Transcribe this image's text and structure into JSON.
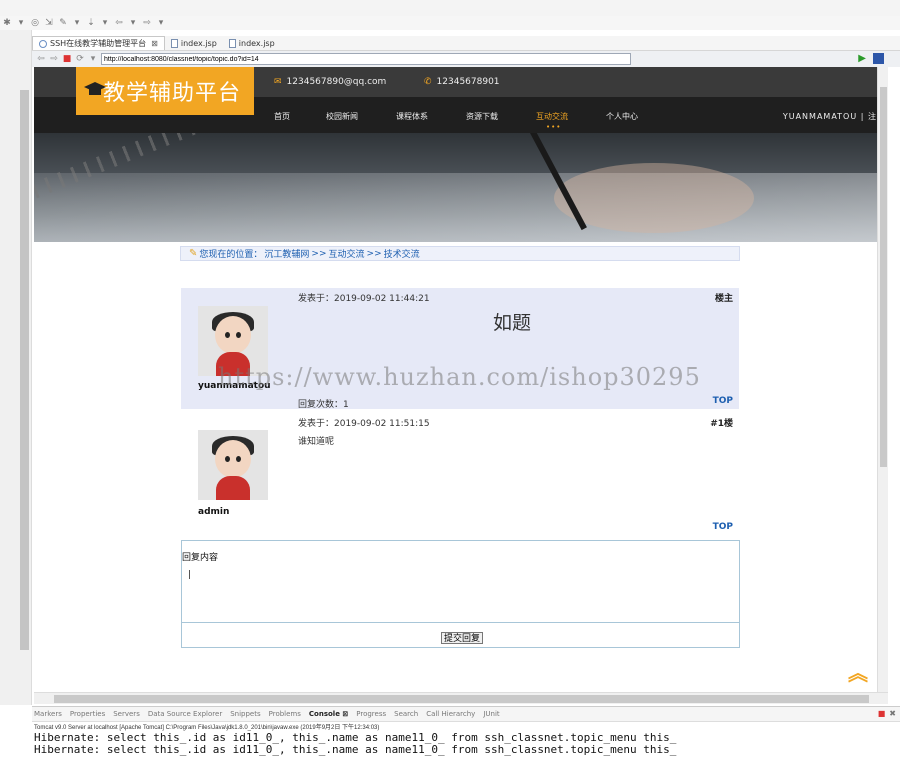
{
  "ide": {
    "editor_tabs": [
      {
        "label": "SSH在线教学辅助管理平台",
        "active": true
      },
      {
        "label": "index.jsp",
        "active": false
      },
      {
        "label": "index.jsp",
        "active": false
      }
    ],
    "tab_close": "⊠",
    "url": "http://localhost:8080/classnet/topic/topic.do?id=14",
    "console_tabs": [
      "Markers",
      "Properties",
      "Servers",
      "Data Source Explorer",
      "Snippets",
      "Problems",
      "Console ⊠",
      "Progress",
      "Search",
      "Call Hierarchy",
      "JUnit"
    ],
    "console_active_index": 6,
    "console_status": "Tomcat v9.0 Server at localhost [Apache Tomcat] C:\\Program Files\\Java\\jdk1.8.0_201\\bin\\javaw.exe (2019年9月2日 下午12:34:03)",
    "console_lines": [
      "Hibernate: select this_.id as id11_0_, this_.name as name11_0_ from ssh_classnet.topic_menu this_",
      "Hibernate: select this_.id as id11_0_, this_.name as name11_0_ from ssh_classnet.topic_menu this_"
    ]
  },
  "site": {
    "logo": "教学辅助平台",
    "email": "1234567890@qq.com",
    "phone": "12345678901",
    "nav": [
      {
        "label": "首页",
        "active": false
      },
      {
        "label": "校园新闻",
        "active": false
      },
      {
        "label": "课程体系",
        "active": false
      },
      {
        "label": "资源下载",
        "active": false
      },
      {
        "label": "互动交流",
        "active": true
      },
      {
        "label": "个人中心",
        "active": false
      }
    ],
    "nav_user": "YUANMAMATOU | 注",
    "breadcrumb": {
      "prefix": "您现在的位置：",
      "items": [
        "沉工教辅网",
        ">>",
        "互动交流",
        ">>",
        "技术交流"
      ]
    }
  },
  "posts": [
    {
      "time": "发表于：2019-09-02 11:44:21",
      "floor": "楼主",
      "title": "如题",
      "author": "yuanmamatou",
      "reply_count": "回复次数：1",
      "top": "TOP"
    },
    {
      "time": "发表于：2019-09-02 11:51:15",
      "floor": "#1楼",
      "body": "谁知道呢",
      "author": "admin",
      "top": "TOP"
    }
  ],
  "reply_form": {
    "label": "回复内容",
    "value": "",
    "submit": "提交回复"
  },
  "watermark": "https://www.huzhan.com/ishop30295",
  "colors": {
    "accent": "#f2a623",
    "link": "#1d5fb0",
    "post_bg": "#e6e9f7"
  }
}
